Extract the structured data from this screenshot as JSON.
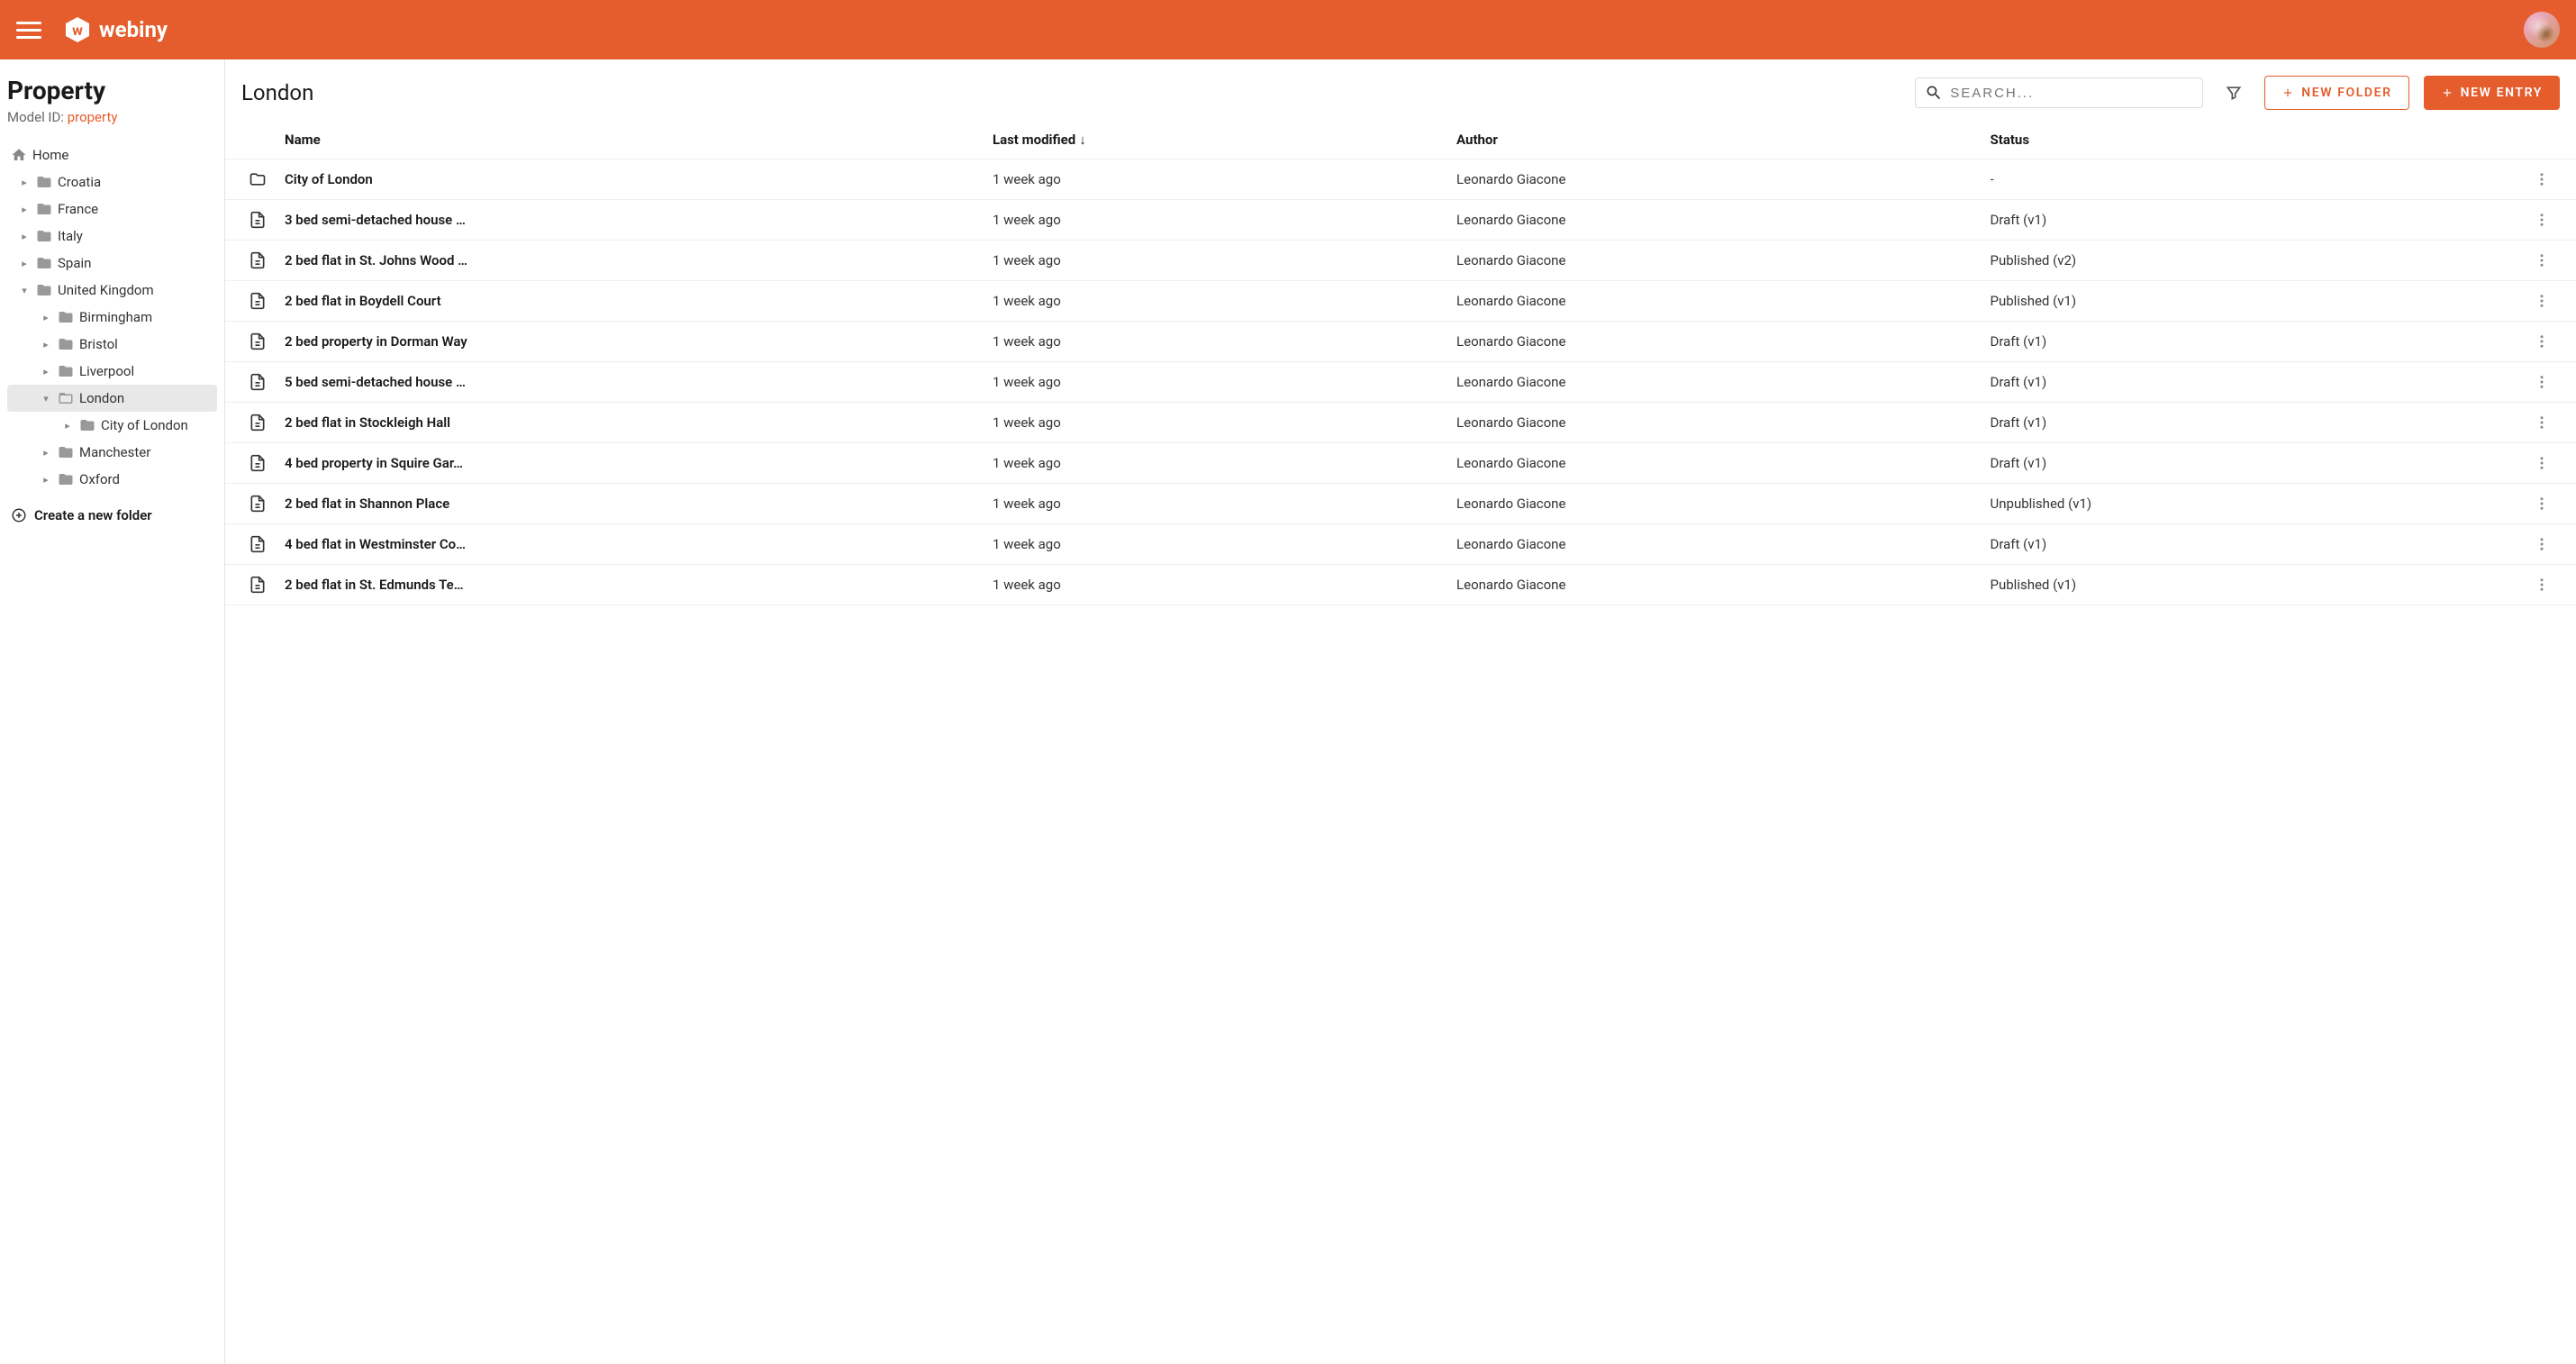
{
  "topbar": {
    "brand": "webiny"
  },
  "sidebar": {
    "title": "Property",
    "model_id_label": "Model ID: ",
    "model_id_value": "property",
    "home_label": "Home",
    "create_folder_label": "Create a new folder",
    "tree": [
      {
        "label": "Croatia",
        "level": 1,
        "expanded": false,
        "selected": false
      },
      {
        "label": "France",
        "level": 1,
        "expanded": false,
        "selected": false
      },
      {
        "label": "Italy",
        "level": 1,
        "expanded": false,
        "selected": false
      },
      {
        "label": "Spain",
        "level": 1,
        "expanded": false,
        "selected": false
      },
      {
        "label": "United Kingdom",
        "level": 1,
        "expanded": true,
        "selected": false
      },
      {
        "label": "Birmingham",
        "level": 2,
        "expanded": false,
        "selected": false
      },
      {
        "label": "Bristol",
        "level": 2,
        "expanded": false,
        "selected": false
      },
      {
        "label": "Liverpool",
        "level": 2,
        "expanded": false,
        "selected": false
      },
      {
        "label": "London",
        "level": 2,
        "expanded": true,
        "selected": true,
        "open": true
      },
      {
        "label": "City of London",
        "level": 3,
        "expanded": false,
        "selected": false
      },
      {
        "label": "Manchester",
        "level": 2,
        "expanded": false,
        "selected": false
      },
      {
        "label": "Oxford",
        "level": 2,
        "expanded": false,
        "selected": false
      }
    ]
  },
  "main": {
    "title": "London",
    "search_placeholder": "SEARCH...",
    "new_folder_label": "NEW FOLDER",
    "new_entry_label": "NEW ENTRY",
    "columns": {
      "name": "Name",
      "modified": "Last modified",
      "author": "Author",
      "status": "Status"
    },
    "rows": [
      {
        "type": "folder",
        "name": "City of London",
        "modified": "1 week ago",
        "author": "Leonardo Giacone",
        "status": "-"
      },
      {
        "type": "entry",
        "name": "3 bed semi-detached house …",
        "modified": "1 week ago",
        "author": "Leonardo Giacone",
        "status": "Draft (v1)"
      },
      {
        "type": "entry",
        "name": "2 bed flat in St. Johns Wood …",
        "modified": "1 week ago",
        "author": "Leonardo Giacone",
        "status": "Published (v2)"
      },
      {
        "type": "entry",
        "name": "2 bed flat in Boydell Court",
        "modified": "1 week ago",
        "author": "Leonardo Giacone",
        "status": "Published (v1)"
      },
      {
        "type": "entry",
        "name": "2 bed property in Dorman Way",
        "modified": "1 week ago",
        "author": "Leonardo Giacone",
        "status": "Draft (v1)"
      },
      {
        "type": "entry",
        "name": "5 bed semi-detached house …",
        "modified": "1 week ago",
        "author": "Leonardo Giacone",
        "status": "Draft (v1)"
      },
      {
        "type": "entry",
        "name": "2 bed flat in Stockleigh Hall",
        "modified": "1 week ago",
        "author": "Leonardo Giacone",
        "status": "Draft (v1)"
      },
      {
        "type": "entry",
        "name": "4 bed property in Squire Gar…",
        "modified": "1 week ago",
        "author": "Leonardo Giacone",
        "status": "Draft (v1)"
      },
      {
        "type": "entry",
        "name": "2 bed flat in Shannon Place",
        "modified": "1 week ago",
        "author": "Leonardo Giacone",
        "status": "Unpublished (v1)"
      },
      {
        "type": "entry",
        "name": "4 bed flat in Westminster Co…",
        "modified": "1 week ago",
        "author": "Leonardo Giacone",
        "status": "Draft (v1)"
      },
      {
        "type": "entry",
        "name": "2 bed flat in St. Edmunds Te…",
        "modified": "1 week ago",
        "author": "Leonardo Giacone",
        "status": "Published (v1)"
      }
    ]
  }
}
